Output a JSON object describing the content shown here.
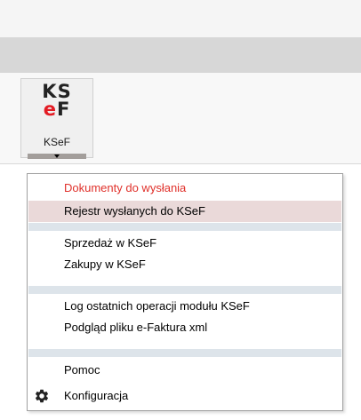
{
  "ribbon": {
    "ksef_logo": {
      "line1": "KS",
      "line2_e": "e",
      "line2_f": "F"
    },
    "ksef_button_label": "KSeF"
  },
  "menu": {
    "items": [
      {
        "label": "Dokumenty do wysłania",
        "color": "#e0312b"
      },
      {
        "label": "Rejestr wysłanych do KSeF",
        "state": "highlighted"
      },
      {
        "label": "Sprzedaż w KSeF"
      },
      {
        "label": "Zakupy w KSeF"
      },
      {
        "label": "Log ostatnich operacji modułu KSeF"
      },
      {
        "label": "Podgląd pliku e-Faktura xml"
      },
      {
        "label": "Pomoc"
      },
      {
        "label": "Konfiguracja",
        "icon": "gear-icon"
      }
    ]
  },
  "colors": {
    "accent_red": "#e31b23",
    "highlight": "#ead9d9",
    "separator": "#dde4ea"
  }
}
